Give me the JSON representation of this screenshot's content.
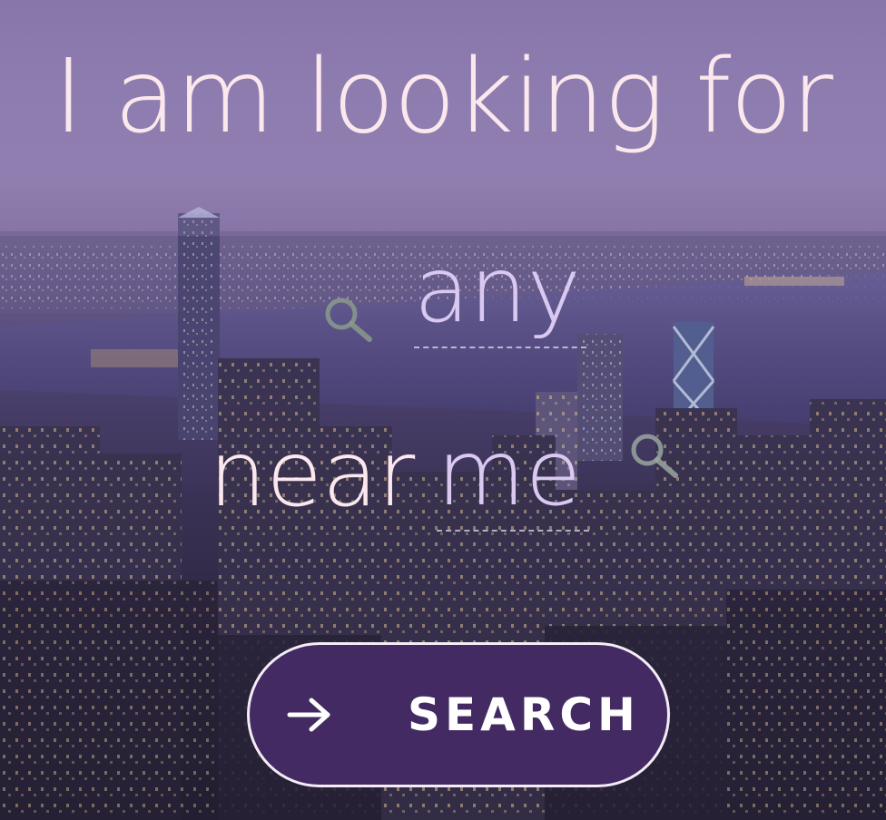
{
  "headline": "I am looking for",
  "what_field": {
    "placeholder": "any",
    "value": "",
    "icon": "search-icon"
  },
  "where_field": {
    "label": "near",
    "placeholder": "me",
    "value": "",
    "icon": "search-icon"
  },
  "search_button": {
    "label": "SEARCH",
    "icon": "arrow-right-icon"
  },
  "colors": {
    "headline": "#fbe8ec",
    "placeholder": "#d9c8f0",
    "button_bg": "#432a62",
    "button_border": "#f4ecf6"
  }
}
